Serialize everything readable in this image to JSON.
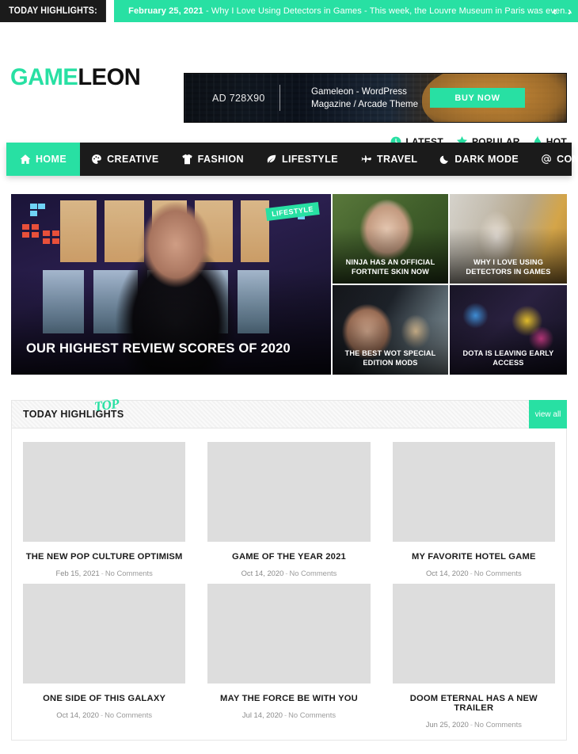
{
  "ticker": {
    "label": "TODAY HIGHLIGHTS:",
    "date": "February 25, 2021",
    "dash": "-",
    "headline": "Why I Love Using Detectors in Games",
    "excerpt": "- This week, the Louvre Museum in Paris was even...",
    "prev_icon": "chevron-left",
    "next_icon": "chevron-right"
  },
  "brand": {
    "part1": "GAME",
    "part2": "LEON"
  },
  "ad": {
    "size_label": "AD 728X90",
    "copy_line1": "Gameleon - WordPress",
    "copy_line2": "Magazine / Arcade Theme",
    "button": "BUY NOW"
  },
  "meta_links": [
    {
      "label": "LATEST",
      "icon": "clock-icon"
    },
    {
      "label": "POPULAR",
      "icon": "star-icon"
    },
    {
      "label": "HOT",
      "icon": "flame-icon"
    }
  ],
  "nav": {
    "items": [
      {
        "label": "HOME",
        "icon": "home-icon",
        "active": true
      },
      {
        "label": "CREATIVE",
        "icon": "palette-icon",
        "active": false
      },
      {
        "label": "FASHION",
        "icon": "tshirt-icon",
        "active": false
      },
      {
        "label": "LIFESTYLE",
        "icon": "leaf-icon",
        "active": false
      },
      {
        "label": "TRAVEL",
        "icon": "plane-icon",
        "active": false
      },
      {
        "label": "DARK MODE",
        "icon": "moon-icon",
        "active": false
      },
      {
        "label": "CONTACT",
        "icon": "at-icon",
        "active": false
      }
    ],
    "search_icon": "search-icon"
  },
  "hero": {
    "featured": {
      "title": "OUR HIGHEST REVIEW SCORES OF 2020",
      "tag": "LIFESTYLE"
    },
    "cards": [
      {
        "title": "NINJA HAS AN OFFICIAL FORTNITE SKIN NOW"
      },
      {
        "title": "WHY I LOVE USING DETECTORS IN GAMES"
      },
      {
        "title": "THE BEST WOT SPECIAL EDITION MODS"
      },
      {
        "title": "DOTA IS LEAVING EARLY ACCESS"
      }
    ]
  },
  "highlights": {
    "title": "TODAY HIGHLIGHTS",
    "badge": "TOP",
    "view_all": "view all",
    "comments_label": "No Comments",
    "separator": "-",
    "posts": [
      {
        "title": "THE NEW POP CULTURE OPTIMISM",
        "date": "Feb 15, 2021",
        "comments": "No Comments"
      },
      {
        "title": "GAME OF THE YEAR 2021",
        "date": "Oct 14, 2020",
        "comments": "No Comments"
      },
      {
        "title": "MY FAVORITE HOTEL GAME",
        "date": "Oct 14, 2020",
        "comments": "No Comments"
      },
      {
        "title": "ONE SIDE OF THIS GALAXY",
        "date": "Oct 14, 2020",
        "comments": "No Comments"
      },
      {
        "title": "MAY THE FORCE BE WITH YOU",
        "date": "Jul 14, 2020",
        "comments": "No Comments"
      },
      {
        "title": "DOOM ETERNAL HAS A NEW TRAILER",
        "date": "Jun 25, 2020",
        "comments": "No Comments"
      }
    ]
  },
  "colors": {
    "accent": "#28e0a3",
    "dark": "#1b1b1b",
    "text": "#1b1b1b",
    "muted": "#9b9b9b"
  }
}
